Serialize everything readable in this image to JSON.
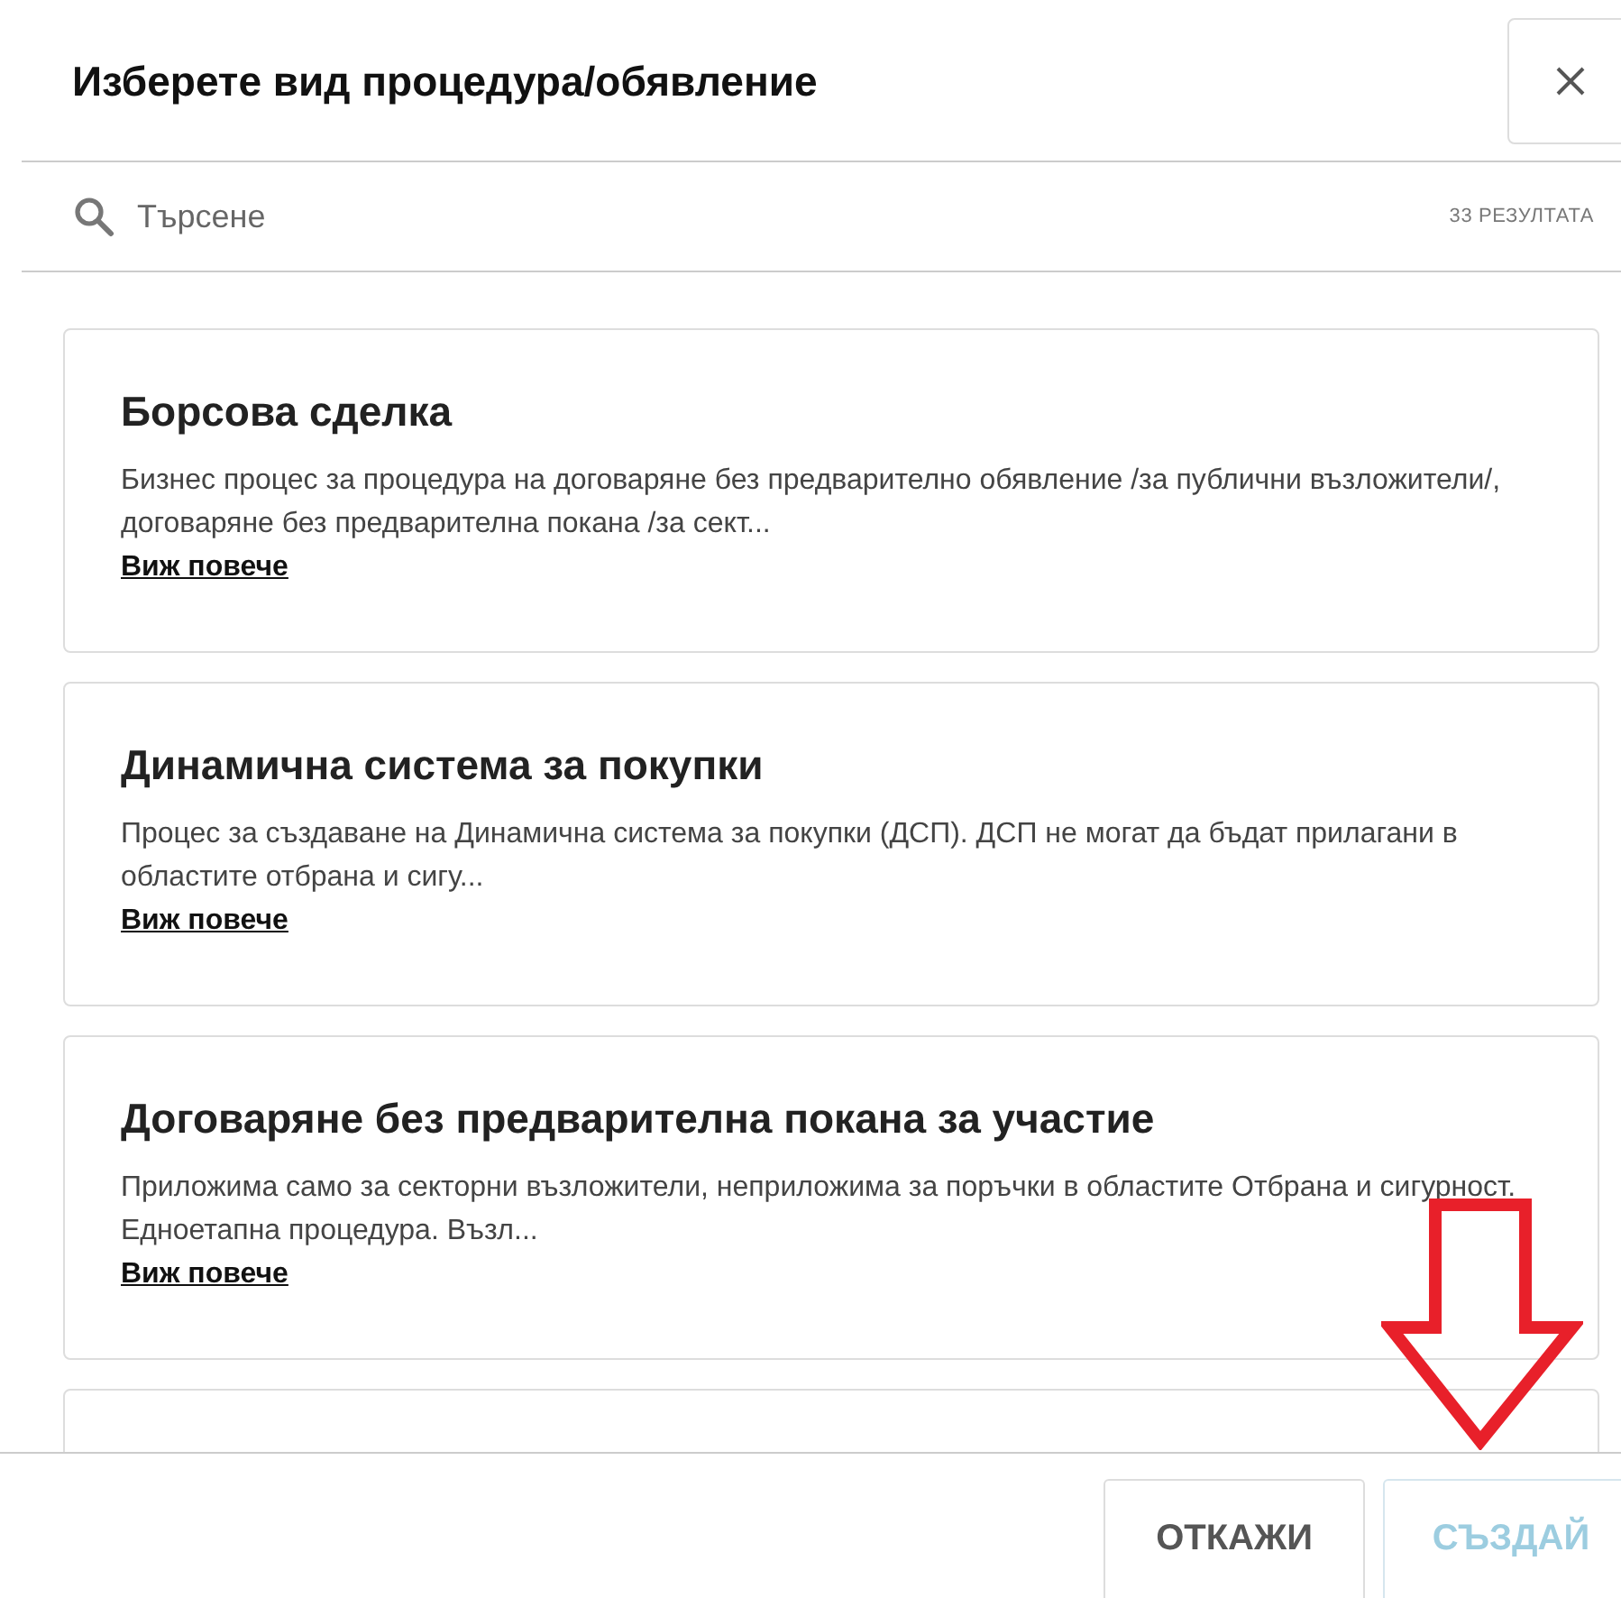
{
  "dialog": {
    "title": "Изберете вид процедура/обявление"
  },
  "search": {
    "placeholder": "Търсене",
    "results_count": "33 РЕЗУЛТАТА"
  },
  "procedures": [
    {
      "title": "Борсова сделка",
      "description": "Бизнес процес за процедура на договаряне без предварително обявление /за публични възложители/, договаряне без предварителна покана /за сект...",
      "link": "Виж повече"
    },
    {
      "title": "Динамична система за покупки",
      "description": "Процес за създаване на Динамична система за покупки (ДСП). ДСП не могат да бъдат прилагани в областите отбрана и сигу...",
      "link": "Виж повече"
    },
    {
      "title": "Договаряне без предварителна покана за участие",
      "description": "Приложима само за секторни възложители, неприложима за поръчки в областите Отбрана и сигурност. Едноетапна процедура. Възл...",
      "link": "Виж повече"
    }
  ],
  "buttons": [
    {
      "label": "ОТКАЖИ",
      "kind": "secondary",
      "disabled": false
    },
    {
      "label": "СЪЗДАЙ",
      "kind": "primary",
      "disabled": true
    }
  ]
}
